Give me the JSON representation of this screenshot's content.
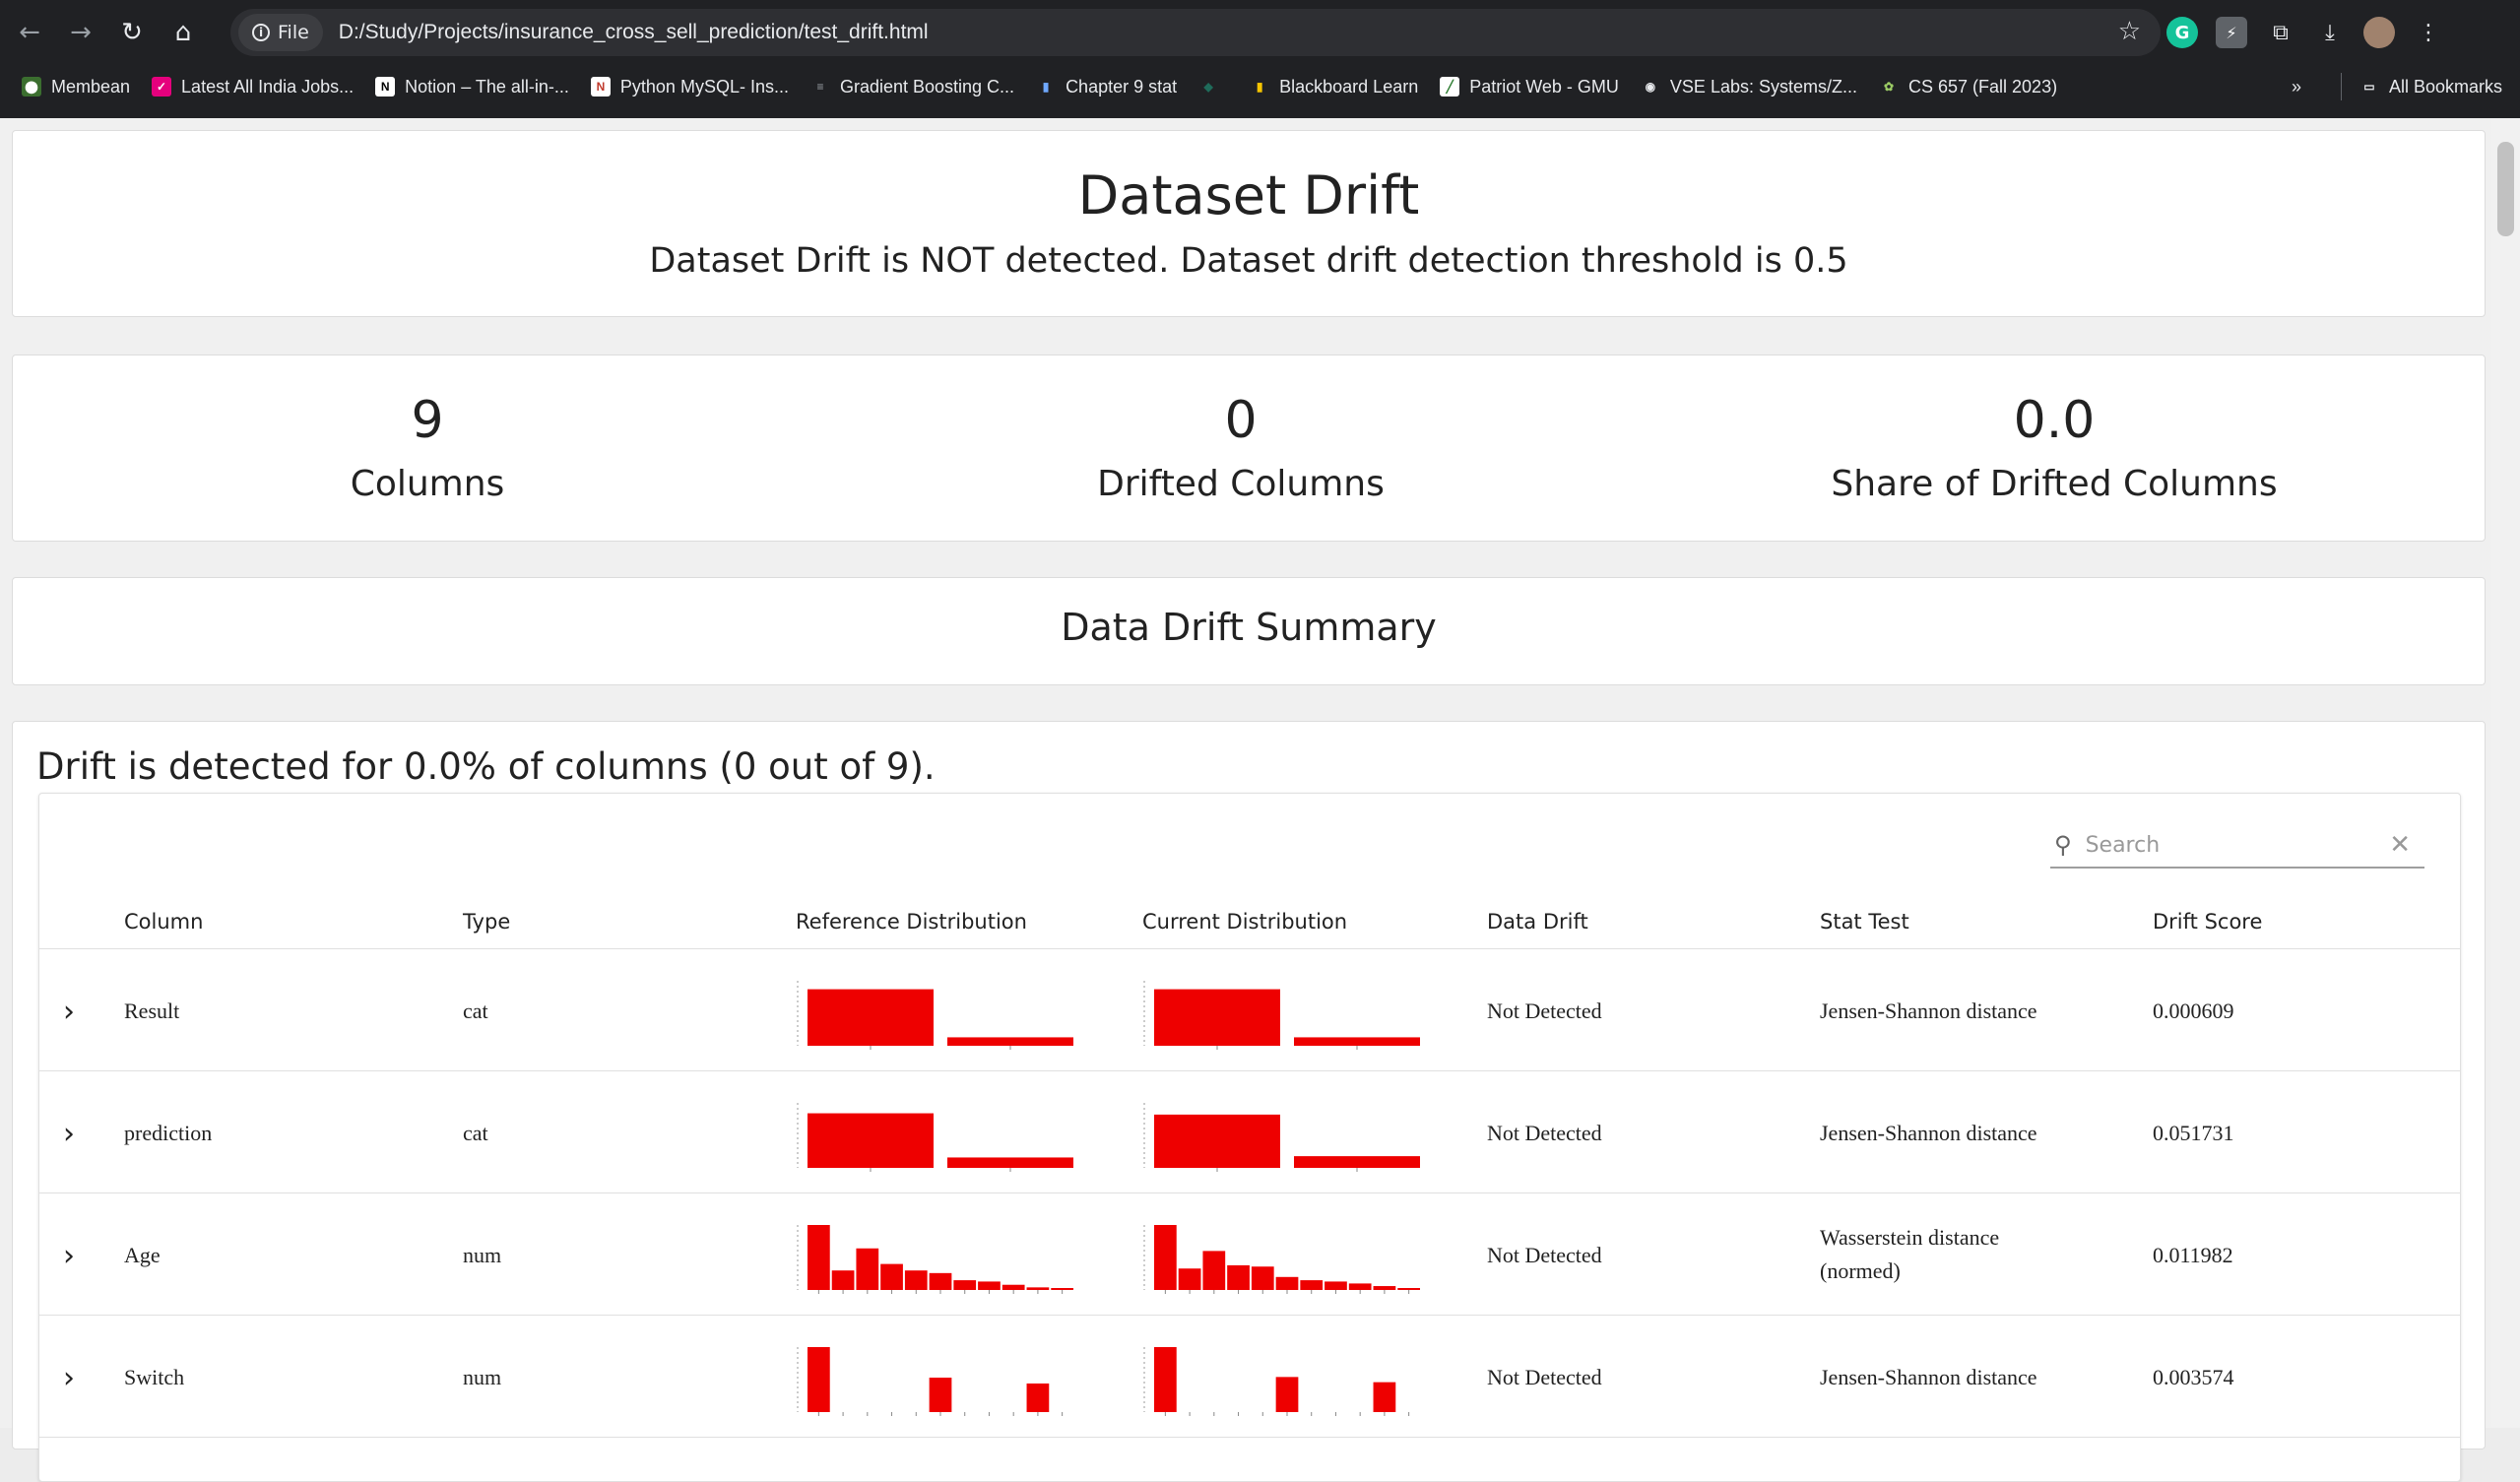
{
  "browser": {
    "chip_label": "File",
    "url": "D:/Study/Projects/insurance_cross_sell_prediction/test_drift.html",
    "bookmarks": [
      {
        "label": "Membean",
        "color": "#1a1a1a"
      },
      {
        "label": "Latest All India Jobs...",
        "color": "#e5007d"
      },
      {
        "label": "Notion – The all-in-...",
        "color": "#ffffff"
      },
      {
        "label": "Python MySQL- Ins...",
        "color": "#ffffff"
      },
      {
        "label": "Gradient Boosting C...",
        "color": "#202124"
      },
      {
        "label": "Chapter 9 stat",
        "color": "#202124"
      },
      {
        "label": "",
        "color": "#1f6b5a"
      },
      {
        "label": "Blackboard Learn",
        "color": "#202124"
      },
      {
        "label": "Patriot Web - GMU",
        "color": "#ffffff"
      },
      {
        "label": "VSE Labs: Systems/Z...",
        "color": "#202124"
      },
      {
        "label": "CS 657 (Fall 2023)",
        "color": "#202124"
      }
    ],
    "all_bookmarks_label": "All Bookmarks"
  },
  "header": {
    "title": "Dataset Drift",
    "subtitle": "Dataset Drift is NOT detected. Dataset drift detection threshold is 0.5"
  },
  "counters": [
    {
      "value": "9",
      "label": "Columns"
    },
    {
      "value": "0",
      "label": "Drifted Columns"
    },
    {
      "value": "0.0",
      "label": "Share of Drifted Columns"
    }
  ],
  "summary_title": "Data Drift Summary",
  "drift_statement": "Drift is detected for 0.0% of columns (0 out of 9).",
  "search_placeholder": "Search",
  "table": {
    "headers": [
      "Column",
      "Type",
      "Reference Distribution",
      "Current Distribution",
      "Data Drift",
      "Stat Test",
      "Drift Score"
    ],
    "bar_color": "#ee0000",
    "rows": [
      {
        "column": "Result",
        "type": "cat",
        "ref": [
          0.87,
          0.13
        ],
        "cur": [
          0.87,
          0.13
        ],
        "drift": "Not Detected",
        "test": "Jensen-Shannon distance",
        "test2": "",
        "score": "0.000609"
      },
      {
        "column": "prediction",
        "type": "cat",
        "ref": [
          0.84,
          0.16
        ],
        "cur": [
          0.82,
          0.18
        ],
        "drift": "Not Detected",
        "test": "Jensen-Shannon distance",
        "test2": "",
        "score": "0.051731"
      },
      {
        "column": "Age",
        "type": "num",
        "ref": [
          1.0,
          0.3,
          0.64,
          0.4,
          0.3,
          0.26,
          0.15,
          0.13,
          0.08,
          0.04,
          0.02
        ],
        "cur": [
          1.0,
          0.33,
          0.6,
          0.38,
          0.36,
          0.2,
          0.15,
          0.13,
          0.1,
          0.06,
          0.01
        ],
        "drift": "Not Detected",
        "test": "Wasserstein distance",
        "test2": "(normed)",
        "score": "0.011982"
      },
      {
        "column": "Switch",
        "type": "num",
        "ref": [
          1.0,
          0,
          0,
          0,
          0,
          0.53,
          0,
          0,
          0,
          0.44,
          0
        ],
        "cur": [
          1.0,
          0,
          0,
          0,
          0,
          0.54,
          0,
          0,
          0,
          0.46,
          0
        ],
        "drift": "Not Detected",
        "test": "Jensen-Shannon distance",
        "test2": "",
        "score": "0.003574"
      }
    ]
  }
}
